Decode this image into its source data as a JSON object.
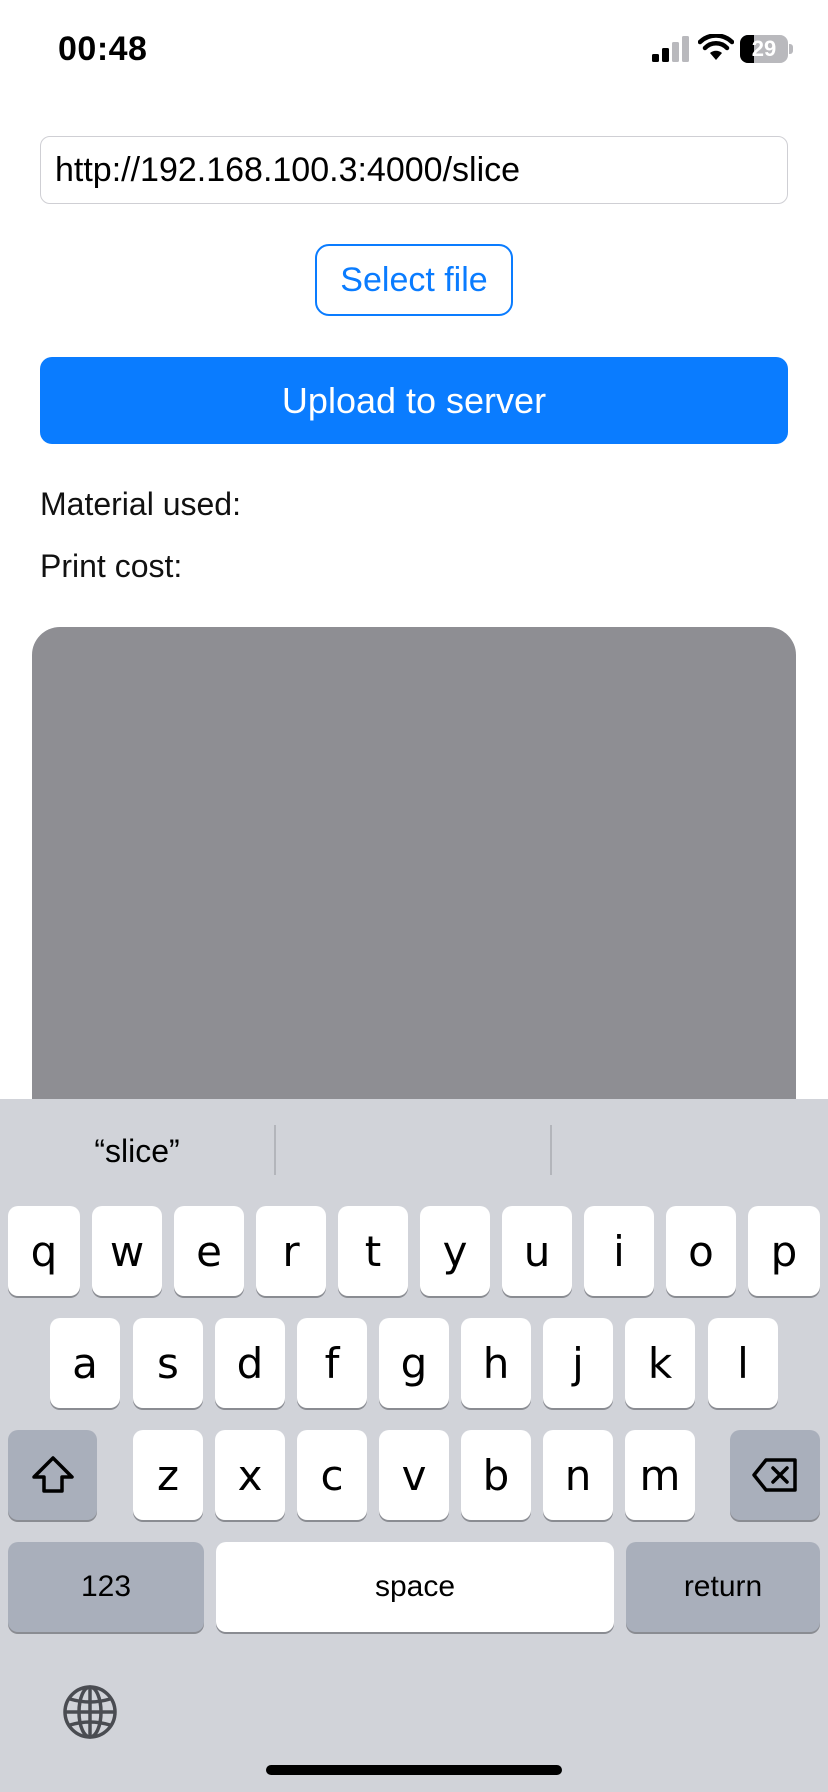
{
  "status_bar": {
    "time": "00:48",
    "battery_level": "29",
    "battery_fraction": 0.29
  },
  "form": {
    "url_value": "http://192.168.100.3:4000/slice",
    "select_file_label": "Select file",
    "upload_label": "Upload to server",
    "material_label": "Material used:",
    "cost_label": "Print cost:"
  },
  "keyboard": {
    "suggestions": [
      "“slice”",
      "",
      ""
    ],
    "row1": [
      "q",
      "w",
      "e",
      "r",
      "t",
      "y",
      "u",
      "i",
      "o",
      "p"
    ],
    "row2": [
      "a",
      "s",
      "d",
      "f",
      "g",
      "h",
      "j",
      "k",
      "l"
    ],
    "row3": [
      "z",
      "x",
      "c",
      "v",
      "b",
      "n",
      "m"
    ],
    "numbers_label": "123",
    "space_label": "space",
    "return_label": "return"
  },
  "colors": {
    "accent": "#0a7cff",
    "preview_bg": "#8e8e93",
    "keyboard_bg": "#d1d3d9"
  }
}
